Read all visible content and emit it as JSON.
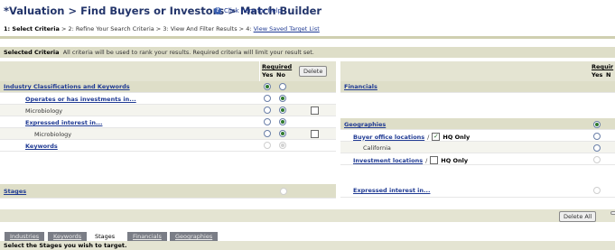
{
  "header": {
    "title": "*Valuation > Find Buyers or Investors > Match Builder",
    "help_label": "Click here for help",
    "help_icon": "help-icon"
  },
  "steps": {
    "step1": "1: Select Criteria",
    "sep": " > ",
    "step2": "2: Refine Your Search Criteria",
    "step3": "3: View And Filter Results",
    "step4": "4:",
    "step4_link": "View Saved Target List"
  },
  "selected_criteria": {
    "label": "Selected Criteria",
    "note": "All criteria will be used to rank your results. Required criteria will limit your result set."
  },
  "left_panel": {
    "required_label": "Required",
    "yes_label": "Yes",
    "no_label": "No",
    "delete_label": "Delete",
    "rows": [
      {
        "label": "Industry Classifications and Keywords"
      },
      {
        "label": "Operates or has investments in..."
      },
      {
        "label": "Microbiology"
      },
      {
        "label": "Expressed interest in..."
      },
      {
        "label": "Microbiology"
      },
      {
        "label": "Keywords"
      },
      {
        "label": "Stages"
      }
    ]
  },
  "right_panel": {
    "required_label": "Requir",
    "yes_label": "Yes",
    "no_label": "N",
    "rows": [
      {
        "label": "Financials"
      },
      {
        "label": "Geographies"
      },
      {
        "label": "Buyer office locations"
      },
      {
        "label": "HQ Only"
      },
      {
        "label": "California"
      },
      {
        "label": "Investment locations"
      },
      {
        "label": "HQ Only"
      },
      {
        "label": "Expressed interest in..."
      }
    ],
    "slash": "/",
    "check_mark": "✓"
  },
  "delete_all_label": "Delete All",
  "tabs": [
    {
      "label": "Industries",
      "active": false
    },
    {
      "label": "Keywords",
      "active": false
    },
    {
      "label": "Stages",
      "active": true
    },
    {
      "label": "Financials",
      "active": false
    },
    {
      "label": "Geographies",
      "active": false
    }
  ],
  "tab_instruction": "Select the Stages you wish to target."
}
